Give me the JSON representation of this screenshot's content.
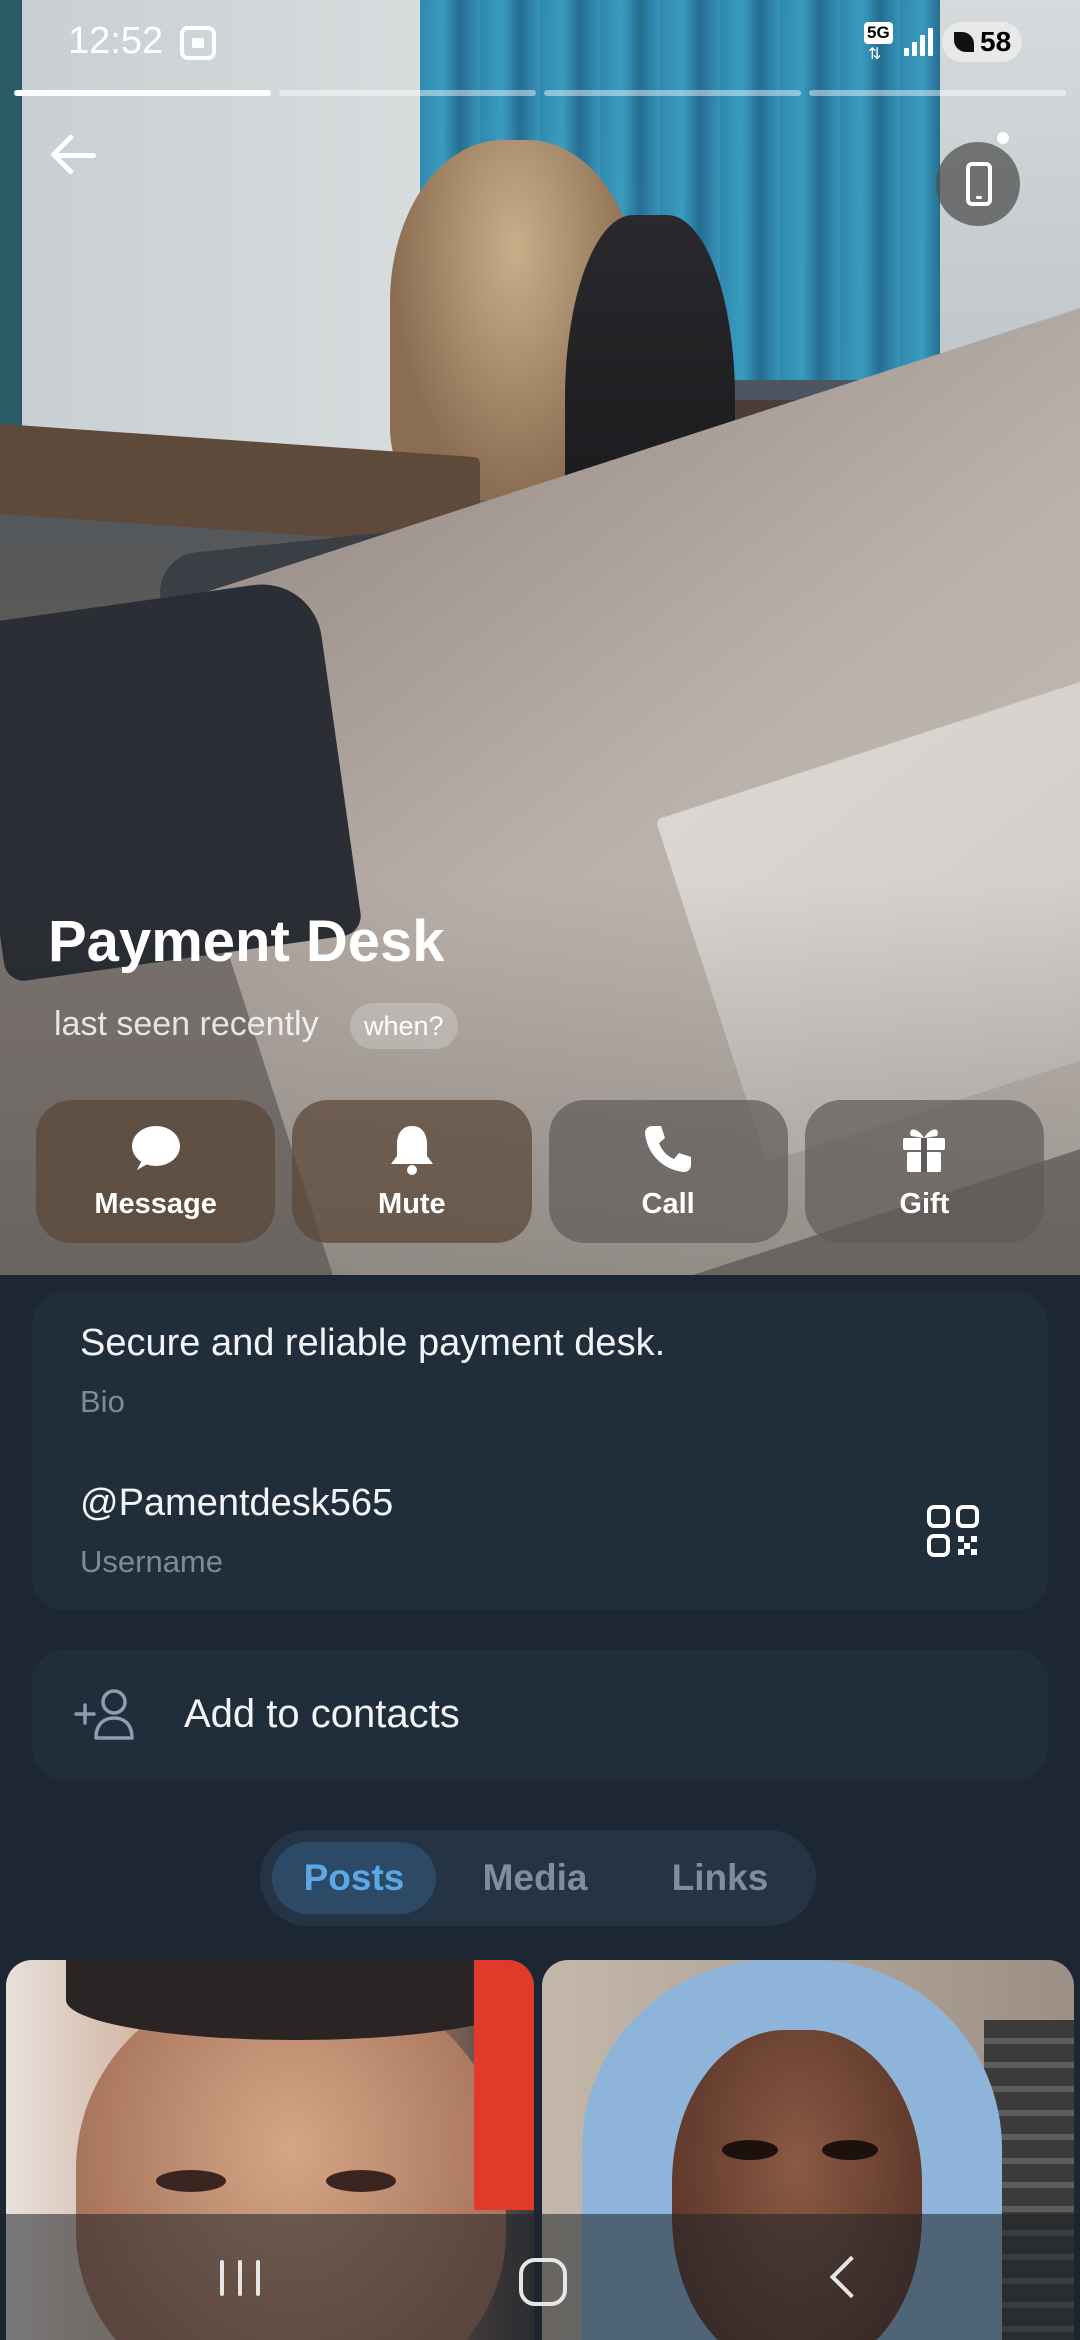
{
  "status_bar": {
    "time": "12:52",
    "network": "5G",
    "battery": "58"
  },
  "story_progress": {
    "segments": 4,
    "active_index": 0
  },
  "profile": {
    "name": "Payment Desk",
    "status": "last seen recently",
    "when_chip": "when?"
  },
  "actions": [
    {
      "label": "Message",
      "icon": "message-icon"
    },
    {
      "label": "Mute",
      "icon": "bell-icon"
    },
    {
      "label": "Call",
      "icon": "phone-icon"
    },
    {
      "label": "Gift",
      "icon": "gift-icon"
    }
  ],
  "info": {
    "bio": "Secure and reliable payment desk.",
    "bio_caption": "Bio",
    "username": "@Pamentdesk565",
    "username_caption": "Username"
  },
  "contacts": {
    "add_label": "Add to contacts"
  },
  "tabs": [
    {
      "label": "Posts",
      "active": true
    },
    {
      "label": "Media",
      "active": false
    },
    {
      "label": "Links",
      "active": false
    }
  ],
  "colors": {
    "background": "#1c2733",
    "card": "#202d3b",
    "accent": "#5aa9e6",
    "caption": "#7d8b99"
  }
}
